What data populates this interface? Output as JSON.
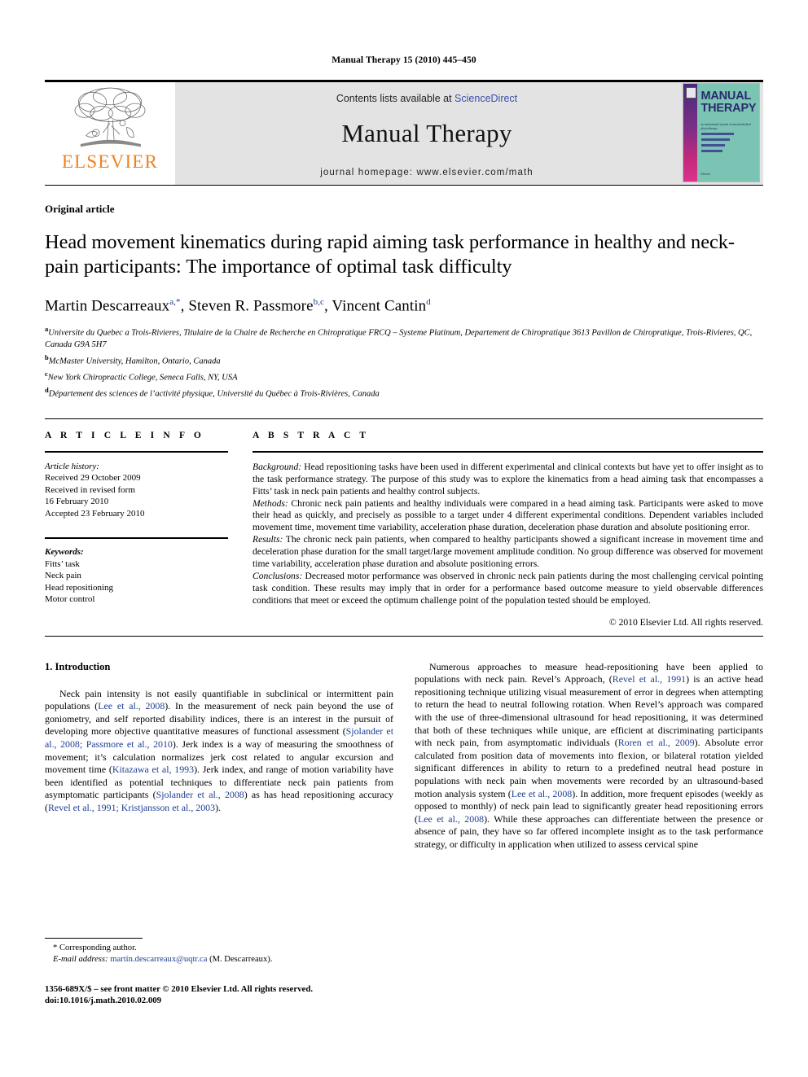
{
  "running_head": "Manual Therapy 15 (2010) 445–450",
  "masthead": {
    "publisher_logo_label": "ELSEVIER",
    "contents_prefix": "Contents lists available at ",
    "contents_link": "ScienceDirect",
    "journal_name": "Manual Therapy",
    "homepage": "journal homepage: www.elsevier.com/math",
    "cover": {
      "title_line1": "MANUAL",
      "title_line2": "THERAPY",
      "subtitle": "an international journal of musculoskeletal physiotherapy",
      "footer": "Elsevier"
    }
  },
  "article": {
    "kicker": "Original article",
    "title": "Head movement kinematics during rapid aiming task performance in healthy and neck-pain participants: The importance of optimal task difficulty",
    "authors": [
      {
        "name": "Martin Descarreaux",
        "marks": "a,*"
      },
      {
        "name": "Steven R. Passmore",
        "marks": "b,c"
      },
      {
        "name": "Vincent Cantin",
        "marks": "d"
      }
    ],
    "affiliations": [
      {
        "mark": "a",
        "text": "Universite du Quebec a Trois-Rivieres, Titulaire de la Chaire de Recherche en Chiropratique FRCQ – Systeme Platinum, Departement de Chiropratique 3613 Pavillon de Chiropratique, Trois-Rivieres, QC, Canada G9A 5H7"
      },
      {
        "mark": "b",
        "text": "McMaster University, Hamilton, Ontario, Canada"
      },
      {
        "mark": "c",
        "text": "New York Chiropractic College, Seneca Falls, NY, USA"
      },
      {
        "mark": "d",
        "text": "Département des sciences de l’activité physique, Université du Québec à Trois-Rivières, Canada"
      }
    ]
  },
  "article_info": {
    "heading": "A R T I C L E  I N F O",
    "history_label": "Article history:",
    "history": [
      "Received 29 October 2009",
      "Received in revised form",
      "16 February 2010",
      "Accepted 23 February 2010"
    ],
    "keywords_label": "Keywords:",
    "keywords": [
      "Fitts’ task",
      "Neck pain",
      "Head repositioning",
      "Motor control"
    ]
  },
  "abstract": {
    "heading": "A B S T R A C T",
    "sections": [
      {
        "label": "Background:",
        "text": " Head repositioning tasks have been used in different experimental and clinical contexts but have yet to offer insight as to the task performance strategy. The purpose of this study was to explore the kinematics from a head aiming task that encompasses a Fitts’ task in neck pain patients and healthy control subjects."
      },
      {
        "label": "Methods:",
        "text": " Chronic neck pain patients and healthy individuals were compared in a head aiming task. Participants were asked to move their head as quickly, and precisely as possible to a target under 4 different experimental conditions. Dependent variables included movement time, movement time variability, acceleration phase duration, deceleration phase duration and absolute positioning error."
      },
      {
        "label": "Results:",
        "text": " The chronic neck pain patients, when compared to healthy participants showed a significant increase in movement time and deceleration phase duration for the small target/large movement amplitude condition. No group difference was observed for movement time variability, acceleration phase duration and absolute positioning errors."
      },
      {
        "label": "Conclusions:",
        "text": " Decreased motor performance was observed in chronic neck pain patients during the most challenging cervical pointing task condition. These results may imply that in order for a performance based outcome measure to yield observable differences conditions that meet or exceed the optimum challenge point of the population tested should be employed."
      }
    ],
    "copyright": "© 2010 Elsevier Ltd. All rights reserved."
  },
  "introduction": {
    "heading": "1.  Introduction",
    "left_column": [
      {
        "t": "text",
        "v": "Neck pain intensity is not easily quantifiable in subclinical or intermittent pain populations ("
      },
      {
        "t": "cite",
        "v": "Lee et al., 2008"
      },
      {
        "t": "text",
        "v": "). In the measurement of neck pain beyond the use of goniometry, and self reported disability indices, there is an interest in the pursuit of developing more objective quantitative measures of functional assessment ("
      },
      {
        "t": "cite",
        "v": "Sjolander et al., 2008; Passmore et al., 2010"
      },
      {
        "t": "text",
        "v": "). Jerk index is a way of measuring the smoothness of movement; it’s calculation normalizes jerk cost related to angular excursion and movement time ("
      },
      {
        "t": "cite",
        "v": "Kitazawa et al, 1993"
      },
      {
        "t": "text",
        "v": "). Jerk index, and range of motion variability have been identified as potential techniques to differentiate neck pain patients from asymptomatic participants ("
      },
      {
        "t": "cite",
        "v": "Sjolander et al., 2008"
      },
      {
        "t": "text",
        "v": ") as has head repositioning accuracy ("
      },
      {
        "t": "cite",
        "v": "Revel et al., 1991; Kristjansson et al., 2003"
      },
      {
        "t": "text",
        "v": ")."
      }
    ],
    "right_column": [
      {
        "t": "text",
        "v": "Numerous approaches to measure head-repositioning have been applied to populations with neck pain. Revel’s Approach, ("
      },
      {
        "t": "cite",
        "v": "Revel et al., 1991"
      },
      {
        "t": "text",
        "v": ") is an active head repositioning technique utilizing visual measurement of error in degrees when attempting to return the head to neutral following rotation. When Revel’s approach was compared with the use of three-dimensional ultrasound for head repositioning, it was determined that both of these techniques while unique, are efficient at discriminating participants with neck pain, from asymptomatic individuals ("
      },
      {
        "t": "cite",
        "v": "Roren et al., 2009"
      },
      {
        "t": "text",
        "v": "). Absolute error calculated from position data of movements into flexion, or bilateral rotation yielded significant differences in ability to return to a predefined neutral head posture in populations with neck pain when movements were recorded by an ultrasound-based motion analysis system ("
      },
      {
        "t": "cite",
        "v": "Lee et al., 2008"
      },
      {
        "t": "text",
        "v": "). In addition, more frequent episodes (weekly as opposed to monthly) of neck pain lead to significantly greater head repositioning errors ("
      },
      {
        "t": "cite",
        "v": "Lee et al., 2008"
      },
      {
        "t": "text",
        "v": "). While these approaches can differentiate between the presence or absence of pain, they have so far offered incomplete insight as to the task performance strategy, or difficulty in application when utilized to assess cervical spine"
      }
    ]
  },
  "footnotes": {
    "corresponding": "* Corresponding author.",
    "email_label": "E-mail address:",
    "email": "martin.descarreaux@uqtr.ca",
    "email_suffix": "(M. Descarreaux).",
    "imprint_line1": "1356-689X/$ – see front matter © 2010 Elsevier Ltd. All rights reserved.",
    "imprint_line2": "doi:10.1016/j.math.2010.02.009"
  },
  "colors": {
    "link": "#3b4faa",
    "citation": "#1f3e91",
    "elsevier_orange": "#F08221",
    "masthead_gray": "#e3e3e3",
    "cover_teal": "#7bc4b4"
  }
}
